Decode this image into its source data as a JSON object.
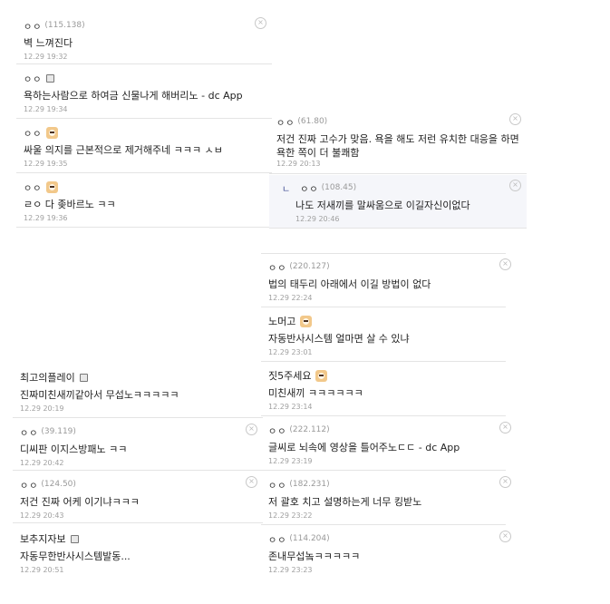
{
  "comments": [
    {
      "nick": "ㅇㅇ",
      "ip": "(115.138)",
      "text": "벽 느껴진다",
      "date": "12.29 19:32"
    },
    {
      "nick": "ㅇㅇ",
      "text": "욕하는사람으로 하여금 신물나게 해버리노 - dc App",
      "date": "12.29 19:34"
    },
    {
      "nick": "ㅇㅇ",
      "text": "싸울 의지를 근본적으로 제거해주네 ㅋㅋㅋ ㅅㅂ",
      "date": "12.29 19:35"
    },
    {
      "nick": "ㅇㅇ",
      "text": "ㄹㅇ 다 좆바르노 ㅋㅋ",
      "date": "12.29 19:36"
    },
    {
      "nick": "ㅇㅇ",
      "ip": "(61.80)",
      "text": "저건 진짜 고수가 맞음. 욕을 해도 저런 유치한 대응을 하면 욕한 쪽이 더 불쾌함",
      "date": "12.29 20:13"
    },
    {
      "nick": "ㅇㅇ",
      "ip": "(108.45)",
      "text": "나도 저새끼를 말싸움으로 이길자신이없다",
      "date": "12.29 20:46",
      "reply_arrow": "ㄴ"
    },
    {
      "nick": "ㅇㅇ",
      "ip": "(220.127)",
      "text": "법의 태두리 아래에서 이길 방법이 없다",
      "date": "12.29 22:24"
    },
    {
      "nick": "노머고",
      "text": "자동반사시스템 얼마면 살 수 있냐",
      "date": "12.29 23:01"
    },
    {
      "nick": "짓5주세요",
      "text": "미친새끼 ㅋㅋㅋㅋㅋㅋ",
      "date": "12.29 23:14"
    },
    {
      "nick": "ㅇㅇ",
      "ip": "(222.112)",
      "text": "글씨로 뇌속에 영상을 틀어주노ㄷㄷ - dc App",
      "date": "12.29 23:19"
    },
    {
      "nick": "ㅇㅇ",
      "ip": "(182.231)",
      "text": "저 괄호 치고 설명하는게 너무 킹받노",
      "date": "12.29 23:22"
    },
    {
      "nick": "ㅇㅇ",
      "ip": "(114.204)",
      "text": "존내무섭놐ㅋㅋㅋㅋㅋ",
      "date": "12.29 23:23"
    },
    {
      "nick": "최고의플레이",
      "text": "진짜미친새끼같아서 무섭노ㅋㅋㅋㅋㅋ",
      "date": "12.29 20:19"
    },
    {
      "nick": "ㅇㅇ",
      "ip": "(39.119)",
      "text": "디씨판 이지스방패노 ㅋㅋ",
      "date": "12.29 20:42"
    },
    {
      "nick": "ㅇㅇ",
      "ip": "(124.50)",
      "text": "저건 진짜 어케 이기냐ㅋㅋㅋ",
      "date": "12.29 20:43"
    },
    {
      "nick": "보추지자보",
      "text": "자동무한반사시스템발동...",
      "date": "12.29 20:51"
    }
  ],
  "delete_glyph": "×"
}
